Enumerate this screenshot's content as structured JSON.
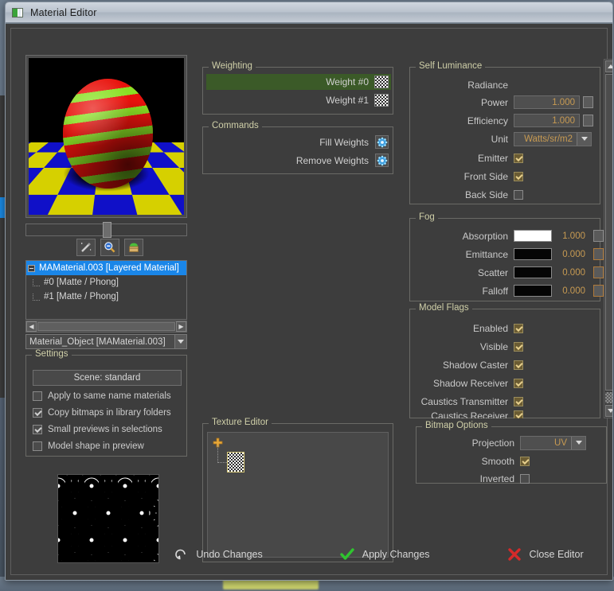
{
  "window": {
    "title": "Material Editor",
    "icon": "app-icon"
  },
  "preview": {
    "name": "material-preview-render",
    "slider_value": "",
    "buttons": [
      {
        "name": "magic-wand-button",
        "icon": "magic-wand-icon"
      },
      {
        "name": "zoom-out-button",
        "icon": "magnifier-minus-icon"
      },
      {
        "name": "library-button",
        "icon": "library-basket-icon"
      }
    ]
  },
  "tree": {
    "name": "material-tree",
    "nodes": [
      {
        "label": "MAMaterial.003 [Layered Material]",
        "selected": true,
        "level": 0
      },
      {
        "label": "#0 [Matte / Phong]",
        "selected": false,
        "level": 1
      },
      {
        "label": "#1 [Matte / Phong]",
        "selected": false,
        "level": 1
      }
    ],
    "object_combo_value": "Material_Object [MAMaterial.003]"
  },
  "settings": {
    "legend": "Settings",
    "scene_button": "Scene: standard",
    "checkboxes": [
      {
        "label": "Apply to same name materials",
        "checked": false
      },
      {
        "label": "Copy bitmaps in library folders",
        "checked": true
      },
      {
        "label": "Small previews in selections",
        "checked": true
      },
      {
        "label": "Model shape in preview",
        "checked": false
      }
    ]
  },
  "texture_thumbnail": {
    "name": "wave-pattern-thumbnail"
  },
  "weighting": {
    "legend": "Weighting",
    "rows": [
      {
        "label": "Weight #0",
        "selected": true
      },
      {
        "label": "Weight #1",
        "selected": false
      }
    ]
  },
  "commands": {
    "legend": "Commands",
    "rows": [
      {
        "label": "Fill Weights",
        "icon": "gear-icon"
      },
      {
        "label": "Remove Weights",
        "icon": "gear-icon"
      }
    ]
  },
  "texture_editor": {
    "legend": "Texture Editor",
    "add_node_icon": "plus-icon",
    "node_icon": "checker-texture-icon"
  },
  "self_luminance": {
    "legend": "Self Luminance",
    "radiance_label": "Radiance",
    "power": {
      "label": "Power",
      "value": "1.000"
    },
    "efficiency": {
      "label": "Efficiency",
      "value": "1.000"
    },
    "unit": {
      "label": "Unit",
      "value": "Watts/sr/m2"
    },
    "emitter": {
      "label": "Emitter",
      "checked": true
    },
    "front_side": {
      "label": "Front Side",
      "checked": true
    },
    "back_side": {
      "label": "Back Side",
      "checked": false
    }
  },
  "fog": {
    "legend": "Fog",
    "rows": [
      {
        "label": "Absorption",
        "color": "#ffffff",
        "value": "1.000"
      },
      {
        "label": "Emittance",
        "color": "#050505",
        "value": "0.000"
      },
      {
        "label": "Scatter",
        "color": "#050505",
        "value": "0.000"
      },
      {
        "label": "Falloff",
        "color": "#050505",
        "value": "0.000"
      }
    ]
  },
  "model_flags": {
    "legend": "Model Flags",
    "rows": [
      {
        "label": "Enabled",
        "checked": true
      },
      {
        "label": "Visible",
        "checked": true
      },
      {
        "label": "Shadow Caster",
        "checked": true
      },
      {
        "label": "Shadow Receiver",
        "checked": true
      },
      {
        "label": "Caustics Transmitter",
        "checked": true
      },
      {
        "label": "Caustics Receiver",
        "checked": true
      }
    ]
  },
  "bitmap_options": {
    "legend": "Bitmap Options",
    "projection": {
      "label": "Projection",
      "value": "UV"
    },
    "smooth": {
      "label": "Smooth",
      "checked": true
    },
    "inverted": {
      "label": "Inverted",
      "checked": false
    }
  },
  "actions": [
    {
      "label": "Undo Changes",
      "icon": "undo-arrow-icon",
      "color": "#cccccc"
    },
    {
      "label": "Apply Changes",
      "icon": "green-check-icon",
      "color": "#2fc42f"
    },
    {
      "label": "Close Editor",
      "icon": "red-x-icon",
      "color": "#d42a2a"
    }
  ],
  "colors": {
    "window_bg": "#3d3d3d",
    "legend": "#cfcfa8",
    "value_text": "#c79a52",
    "selection_blue": "#1a86e8",
    "selection_green": "#3b5a28"
  }
}
